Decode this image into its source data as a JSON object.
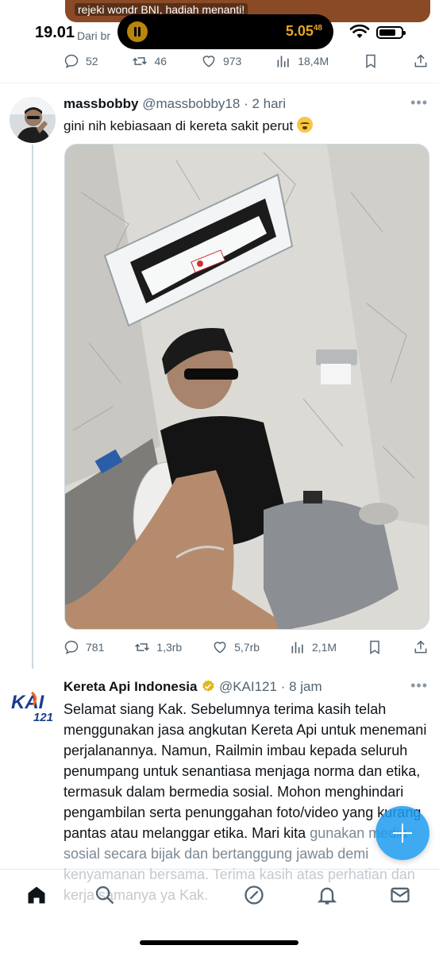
{
  "previous_tweet": {
    "ad_text": "rejeki wondr BNI, hadiah menanti!",
    "source_text": "Dari br",
    "stats": {
      "replies": "52",
      "retweets": "46",
      "likes": "973",
      "views": "18,4M"
    }
  },
  "status_bar": {
    "time": "19.01",
    "timer": "5.05",
    "timer_fraction": "48"
  },
  "tweet": {
    "display_name": "massbobby",
    "handle": "@massbobby18",
    "time": "· 2 hari",
    "text": "gini nih kebiasaan di kereta sakit perut",
    "stats": {
      "replies": "781",
      "retweets": "1,3rb",
      "likes": "5,7rb",
      "views": "2,1M"
    }
  },
  "reply": {
    "logo_text": "KAI",
    "logo_sub": "121",
    "display_name": "Kereta Api Indonesia",
    "handle": "@KAI121",
    "time": "· 8 jam",
    "text_main": "Selamat siang Kak. Sebelumnya terima kasih telah menggunakan jasa angkutan Kereta Api untuk menemani perjalanannya. Namun, Railmin imbau kepada seluruh penumpang untuk senantiasa menjaga norma dan etika, termasuk dalam bermedia sosial. Mohon menghindari pengambilan serta penunggahan foto/video yang kurang pantas atau melanggar etika. Mari kita",
    "text_faded": "gunakan media sosial secara bijak dan bertanggung jawab demi kenyamanan bersama. Terima kasih atas perhatian dan kerja samanya ya Kak."
  },
  "colors": {
    "accent": "#1d9bf0",
    "muted": "#536471",
    "kai_blue": "#1a3c8f",
    "kai_orange": "#f26522",
    "verified_gold": "#e2b719"
  },
  "bottom_nav": [
    "home-icon",
    "search-icon",
    "grok-icon",
    "notifications-icon",
    "messages-icon"
  ]
}
